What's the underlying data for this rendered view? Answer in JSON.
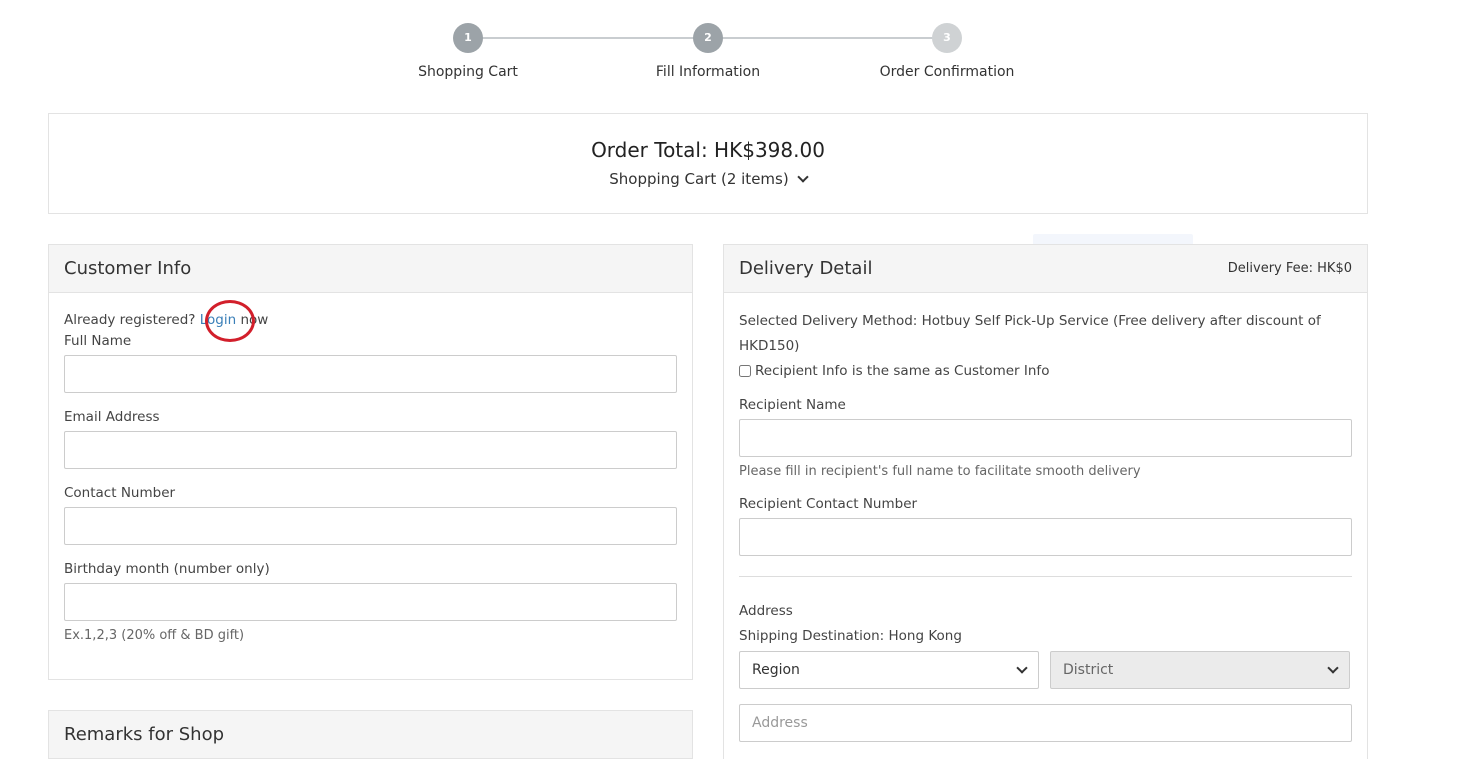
{
  "stepper": {
    "steps": [
      {
        "number": "1",
        "label": "Shopping Cart",
        "color": "#9ca3a8"
      },
      {
        "number": "2",
        "label": "Fill Information",
        "color": "#9ca3a8"
      },
      {
        "number": "3",
        "label": "Order Confirmation",
        "color": "#cfd2d4"
      }
    ]
  },
  "order": {
    "total": "Order Total: HK$398.00",
    "cart_toggle": "Shopping Cart (2 items)"
  },
  "customer": {
    "title": "Customer Info",
    "already_registered": "Already registered? ",
    "login": "Login",
    "now": " now",
    "full_name_label": "Full Name",
    "email_label": "Email Address",
    "contact_label": "Contact Number",
    "birthday_label": "Birthday month (number only)",
    "birthday_hint": "Ex.1,2,3 (20% off & BD gift)"
  },
  "remarks": {
    "title": "Remarks for Shop"
  },
  "delivery": {
    "title": "Delivery Detail",
    "fee": "Delivery Fee: HK$0",
    "method": "Selected Delivery Method: Hotbuy Self Pick-Up Service (Free delivery after discount of HKD150)",
    "same_as_customer": "Recipient Info is the same as Customer Info",
    "recipient_name_label": "Recipient Name",
    "recipient_name_hint": "Please fill in recipient's full name to facilitate smooth delivery",
    "recipient_contact_label": "Recipient Contact Number",
    "address_label": "Address",
    "shipping_destination": "Shipping Destination: Hong Kong",
    "region_select": "Region",
    "district_select": "District",
    "address_placeholder": "Address"
  },
  "colors": {
    "login_link": "#3a7fb8",
    "annotation_circle": "#d21f2b",
    "panel_header_bg": "#f5f5f5"
  }
}
